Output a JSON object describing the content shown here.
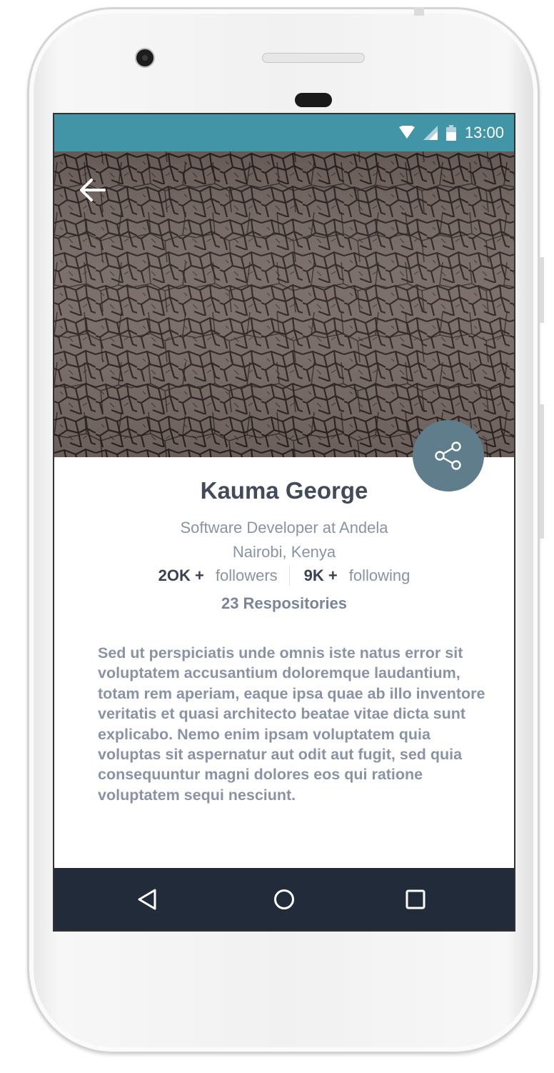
{
  "status_bar": {
    "time": "13:00",
    "icons": [
      "wifi-icon",
      "signal-icon",
      "battery-icon"
    ],
    "background": "#4195a7"
  },
  "header": {
    "back_icon": "arrow-left-icon",
    "share_icon": "share-icon",
    "fab_color": "#607d8b"
  },
  "profile": {
    "name": "Kauma George",
    "title": "Software Developer at Andela",
    "location": "Nairobi, Kenya",
    "followers_count": "2OK +",
    "followers_label": "followers",
    "following_count": "9K +",
    "following_label": "following",
    "repositories": "23 Respositories",
    "bio": "Sed ut perspiciatis unde omnis iste natus error sit voluptatem accusantium doloremque laudantium, totam rem aperiam, eaque ipsa quae ab illo inventore veritatis et quasi architecto beatae vitae dicta sunt explicabo. Nemo enim ipsam voluptatem quia voluptas sit aspernatur aut odit aut fugit, sed quia consequuntur magni dolores eos qui ratione voluptatem sequi nesciunt."
  },
  "nav_bar": {
    "icons": [
      "back-triangle-icon",
      "home-circle-icon",
      "recents-square-icon"
    ],
    "background": "#212b3a"
  }
}
